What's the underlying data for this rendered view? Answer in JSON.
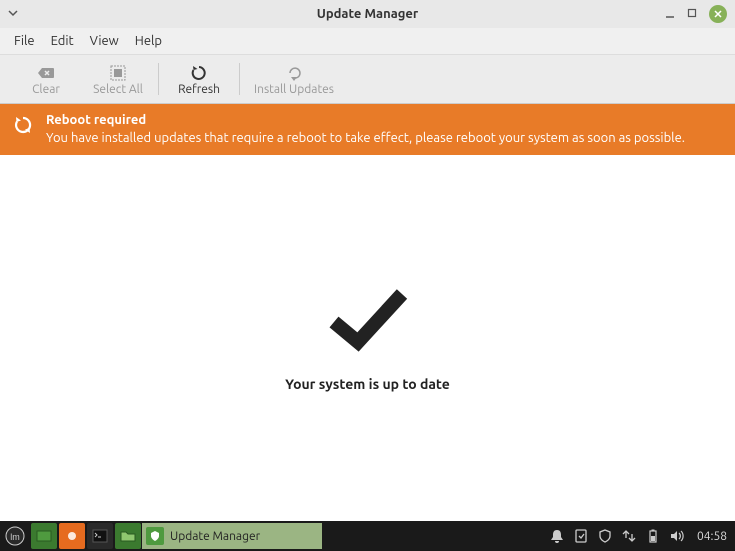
{
  "titlebar": {
    "title": "Update Manager"
  },
  "menubar": {
    "file": "File",
    "edit": "Edit",
    "view": "View",
    "help": "Help"
  },
  "toolbar": {
    "clear": "Clear",
    "select_all": "Select All",
    "refresh": "Refresh",
    "install": "Install Updates"
  },
  "banner": {
    "title": "Reboot required",
    "message": "You have installed updates that require a reboot to take effect, please reboot your system as soon as possible."
  },
  "main": {
    "status": "Your system is up to date"
  },
  "taskbar": {
    "task_label": "Update Manager",
    "clock": "04:58"
  }
}
